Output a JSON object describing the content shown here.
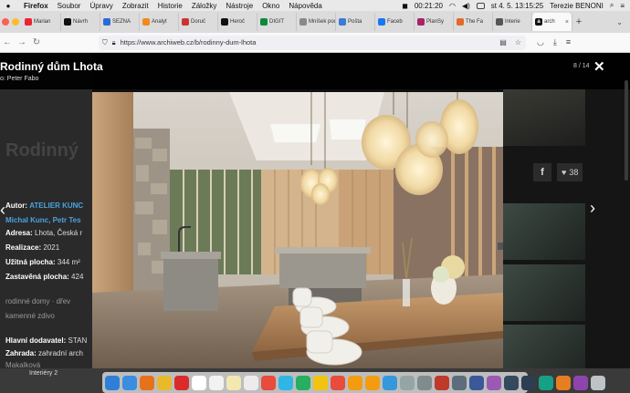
{
  "menubar": {
    "app": "Firefox",
    "items": [
      "Soubor",
      "Úpravy",
      "Zobrazit",
      "Historie",
      "Záložky",
      "Nástroje",
      "Okno",
      "Nápověda"
    ],
    "timer": "00:21:20",
    "datetime": "st 4. 5.  13:15:25",
    "user": "Terezie BENONI"
  },
  "tabs": [
    {
      "label": "Marian",
      "color": "#e23"
    },
    {
      "label": "Návrh",
      "color": "#111"
    },
    {
      "label": "SEZNA",
      "color": "#2a6ad9"
    },
    {
      "label": "Analyt",
      "color": "#f08a1d"
    },
    {
      "label": "Doruč",
      "color": "#c33"
    },
    {
      "label": "Heroč",
      "color": "#111"
    },
    {
      "label": "DIGIT",
      "color": "#0a8a3c"
    },
    {
      "label": "Mníšek pod",
      "color": "#888"
    },
    {
      "label": "Pošta",
      "color": "#3a7bd5"
    },
    {
      "label": "Faceb",
      "color": "#1877f2"
    },
    {
      "label": "PlanSy",
      "color": "#aa2266"
    },
    {
      "label": "The Fa",
      "color": "#e26b2c"
    },
    {
      "label": "Interie",
      "color": "#555"
    }
  ],
  "active_tab": {
    "label": "arch",
    "close": "×"
  },
  "new_tab": "+",
  "url": "https://www.archiweb.cz/b/rodinny-dum-lhota",
  "lightbox": {
    "title": "Rodinný dům Lhota",
    "photo_credit": "o: Peter Fabo",
    "counter": "8 / 14",
    "close": "✕",
    "prev": "‹",
    "next": "›"
  },
  "background": {
    "title": "Rodinný",
    "details": [
      {
        "label": "Autor:",
        "value": "ATELIER KUNC",
        "link": true
      },
      {
        "label": "",
        "value": "Michal Kunc, Petr Tes",
        "link": true
      },
      {
        "label": "Adresa:",
        "value": "Lhota, Česká r"
      },
      {
        "label": "Realizace:",
        "value": "2021"
      },
      {
        "label": "Užitná plocha:",
        "value": "344 m²"
      },
      {
        "label": "Zastavěná plocha:",
        "value": "424"
      },
      {
        "label": "",
        "value": "rodinné domy · dřev"
      },
      {
        "label": "",
        "value": "kamenné zdivo"
      },
      {
        "label": "Hlavní dodavatel:",
        "value": "STAN"
      },
      {
        "label": "Zahrada:",
        "value": "zahradní arch"
      },
      {
        "label": "",
        "value": "Makalková"
      }
    ],
    "likes": "38",
    "fb": "f"
  },
  "dock": {
    "label": "Interiéry 2",
    "icons": [
      "#2f7ed8",
      "#3b8de0",
      "#e8711c",
      "#e9b92c",
      "#d92b2b",
      "#ffffff",
      "#f2f2f2",
      "#f2e8b0",
      "#ececec",
      "#e74c3c",
      "#2fb5e6",
      "#27ae60",
      "#f1c40f",
      "#e74c3c",
      "#f39c12",
      "#f39c12",
      "#3498db",
      "#95a5a6",
      "#7f8c8d",
      "#c0392b",
      "#5d6d7e",
      "#3b5998",
      "#9b59b6",
      "#34495e",
      "#2c3e50",
      "#16a085",
      "#e67e22",
      "#8e44ad",
      "#bdc3c7"
    ]
  }
}
